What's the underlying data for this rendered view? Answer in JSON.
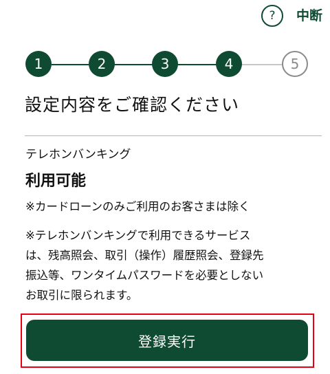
{
  "header": {
    "help_icon_glyph": "?",
    "suspend_label": "中断"
  },
  "stepper": {
    "steps": [
      {
        "label": "1",
        "state": "done"
      },
      {
        "label": "2",
        "state": "done"
      },
      {
        "label": "3",
        "state": "done"
      },
      {
        "label": "4",
        "state": "current"
      },
      {
        "label": "5",
        "state": "todo"
      }
    ]
  },
  "page": {
    "title": "設定内容をご確認ください"
  },
  "setting": {
    "label": "テレホンバンキング",
    "value": "利用可能",
    "note_card_loan": "※カードローンのみご利用のお客さまは除く",
    "note_services": [
      "※テレホンバンキングで利用できるサービス",
      "は、残高照会、取引（操作）履歴照会、登録先",
      "振込等、ワンタイムパスワードを必要としない",
      "お取引に限られます。"
    ]
  },
  "actions": {
    "register_label": "登録実行"
  },
  "colors": {
    "brand_green": "#0f4a33",
    "highlight_red": "#e60012",
    "inactive_gray": "#8a8a8a"
  }
}
